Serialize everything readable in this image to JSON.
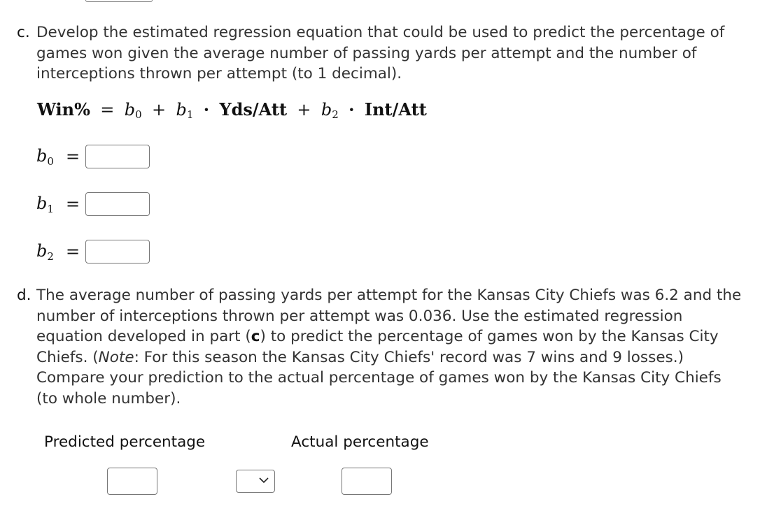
{
  "part_c": {
    "label": "c.",
    "text": "Develop the estimated regression equation that could be used to predict the percentage of games won given the average number of passing yards per attempt and the number of interceptions thrown per attempt (to 1 decimal).",
    "equation": {
      "lhs": "Win%",
      "equals": "=",
      "b0": "b",
      "b0_sub": "0",
      "plus1": "+",
      "b1": "b",
      "b1_sub": "1",
      "dot1": "·",
      "var1": "Yds/Att",
      "plus2": "+",
      "b2": "b",
      "b2_sub": "2",
      "dot2": "·",
      "var2": "Int/Att"
    },
    "coefficients": [
      {
        "symbol": "b",
        "sub": "0",
        "equals": "=",
        "value": ""
      },
      {
        "symbol": "b",
        "sub": "1",
        "equals": "=",
        "value": ""
      },
      {
        "symbol": "b",
        "sub": "2",
        "equals": "=",
        "value": ""
      }
    ]
  },
  "part_d": {
    "label": "d.",
    "text_1": "The average number of passing yards per attempt for the Kansas City Chiefs was 6.2 and the number of interceptions thrown per attempt was 0.036. Use the estimated regression equation developed in part (",
    "part_ref": "c",
    "text_2": ") to predict the percentage of games won by the Kansas City Chiefs. (",
    "note_word": "Note",
    "text_3": ": For this season the Kansas City Chiefs' record was 7 wins and 9 losses.) Compare your prediction to the actual percentage of games won by the Kansas City Chiefs (to whole number).",
    "predicted_label": "Predicted percentage",
    "actual_label": "Actual percentage",
    "predicted_value": "",
    "comparison_selected": "",
    "actual_value": ""
  }
}
